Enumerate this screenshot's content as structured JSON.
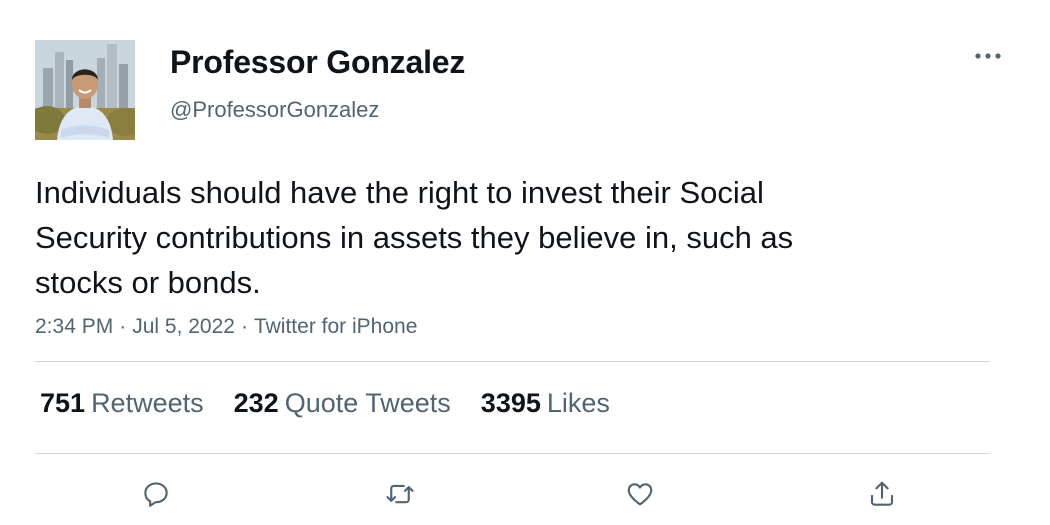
{
  "author": {
    "display_name": "Professor Gonzalez",
    "handle": "@ProfessorGonzalez"
  },
  "tweet": {
    "text": "Individuals should have the right to invest their Social Security contributions in assets they believe in, such as stocks or bonds.",
    "time": "2:34 PM",
    "date": "Jul 5, 2022",
    "source": "Twitter for iPhone",
    "separator": "·"
  },
  "stats": {
    "retweets": {
      "count": "751",
      "label": "Retweets"
    },
    "quote_tweets": {
      "count": "232",
      "label": "Quote Tweets"
    },
    "likes": {
      "count": "3395",
      "label": "Likes"
    }
  },
  "icons": {
    "more": "more-horizontal-icon",
    "reply": "reply-icon",
    "retweet": "retweet-icon",
    "like": "heart-icon",
    "share": "share-icon"
  },
  "colors": {
    "text_primary": "#0f1419",
    "text_secondary": "#536471",
    "divider": "#cfd9de"
  }
}
